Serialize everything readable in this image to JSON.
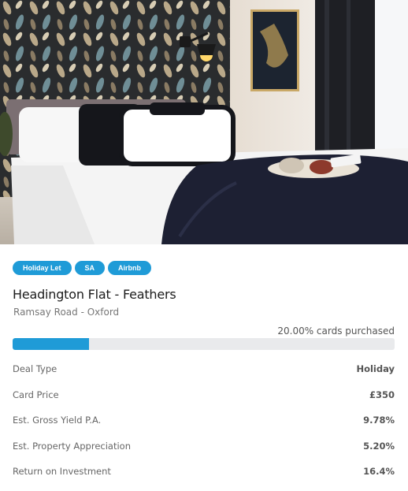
{
  "listing": {
    "tags": [
      "Holiday Let",
      "SA",
      "Airbnb"
    ],
    "title": "Headington Flat - Feathers",
    "location": "Ramsay Road - Oxford",
    "progress": {
      "label": "20.00% cards purchased",
      "fraction": 0.2
    },
    "details": [
      {
        "label": "Deal Type",
        "value": "Holiday"
      },
      {
        "label": "Card Price",
        "value": "£350"
      },
      {
        "label": "Est. Gross Yield P.A.",
        "value": "9.78%"
      },
      {
        "label": "Est. Property Appreciation",
        "value": "5.20%"
      },
      {
        "label": "Return on Investment",
        "value": "16.4%"
      }
    ]
  },
  "colors": {
    "accent": "#1f9bd7",
    "track": "#e9eaec"
  }
}
